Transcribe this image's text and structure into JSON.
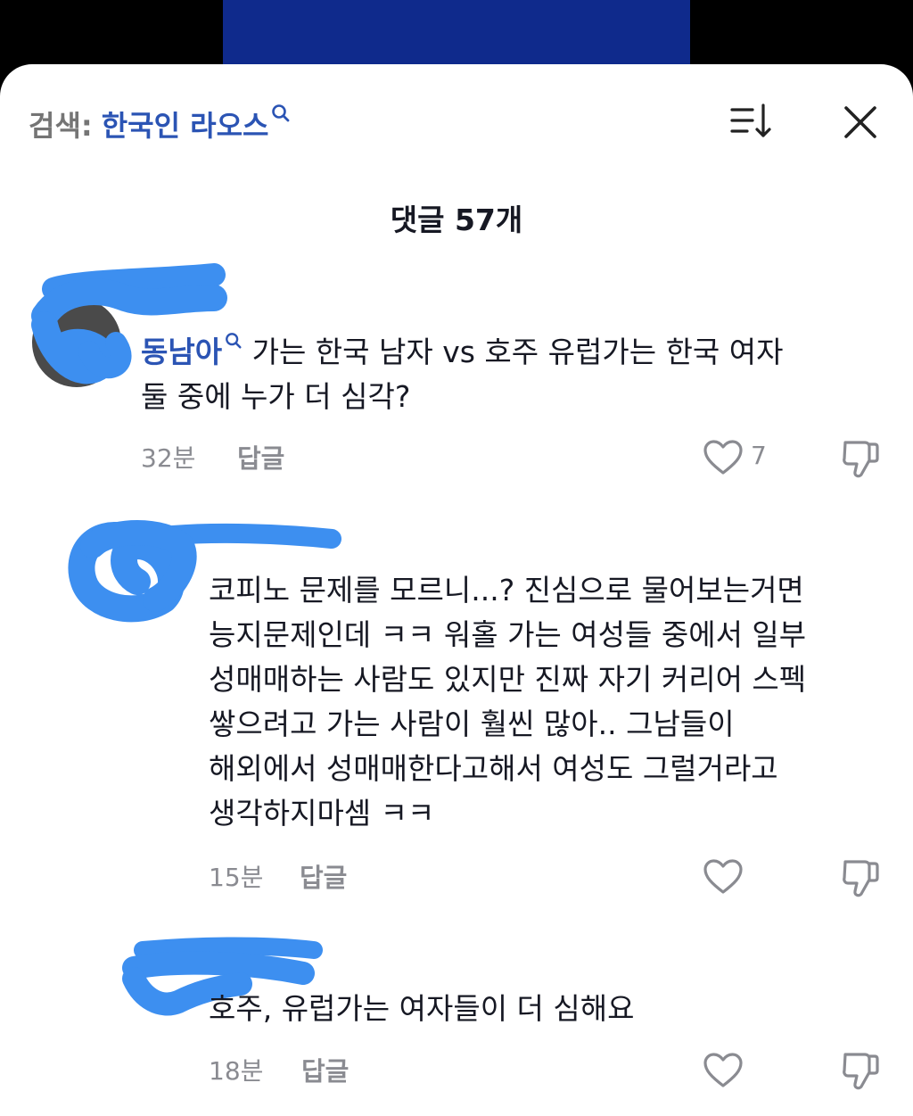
{
  "header": {
    "search_prefix": "검색:",
    "search_query": "한국인 라오스"
  },
  "comments_title": "댓글 57개",
  "comments": [
    {
      "mention": "동남아",
      "text_line1": " 가는 한국 남자 vs 호주 유럽가는 한국 여자",
      "text_line2": "둘 중에 누가 더 심각?",
      "time": "32분",
      "reply_label": "답글",
      "likes": "7"
    },
    {
      "lines": [
        "코피노 문제를 모르니...? 진심으로 물어보는거면",
        "능지문제인데 ㅋㅋ 워홀 가는 여성들 중에서 일부",
        "성매매하는 사람도 있지만 진짜 자기 커리어 스펙",
        "쌓으려고 가는 사람이 훨씬 많아.. 그남들이",
        "해외에서 성매매한다고해서 여성도 그럴거라고",
        "생각하지마셈 ㅋㅋ"
      ],
      "time": "15분",
      "reply_label": "답글"
    },
    {
      "text": "호주, 유럽가는 여자들이 더 심해요",
      "time": "18분",
      "reply_label": "답글"
    }
  ],
  "colors": {
    "accent": "#2b54b4",
    "redaction": "#3d8ff0",
    "muted": "#8a8b91",
    "video_banner": "#0f2a8c"
  }
}
